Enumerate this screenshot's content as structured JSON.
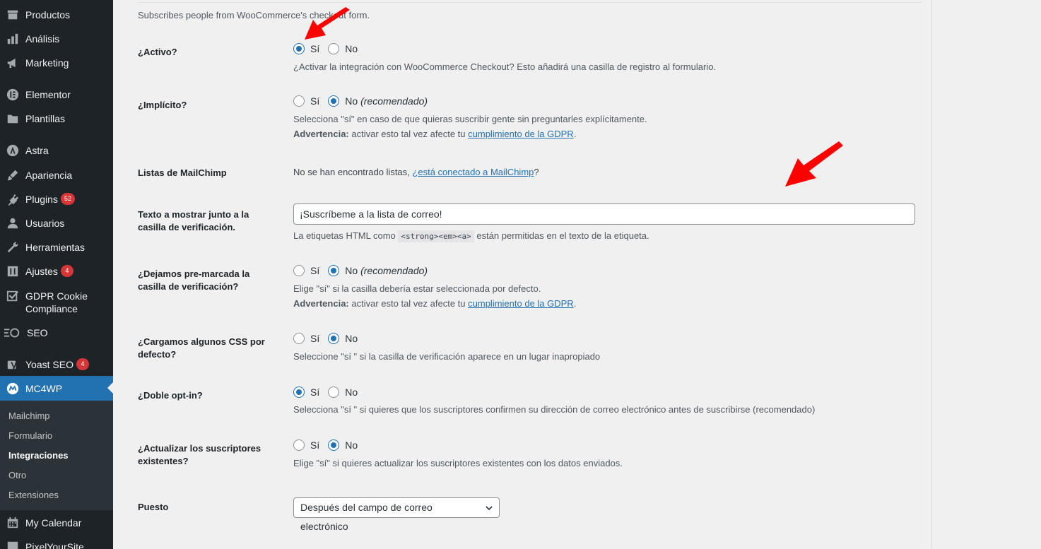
{
  "sidebar": {
    "items": [
      {
        "label": "Productos",
        "icon": "products-icon"
      },
      {
        "label": "Análisis",
        "icon": "analytics-icon"
      },
      {
        "label": "Marketing",
        "icon": "megaphone-icon"
      },
      {
        "label": "Elementor",
        "icon": "elementor-icon"
      },
      {
        "label": "Plantillas",
        "icon": "folder-icon"
      },
      {
        "label": "Astra",
        "icon": "astra-icon"
      },
      {
        "label": "Apariencia",
        "icon": "brush-icon"
      },
      {
        "label": "Plugins",
        "icon": "plugin-icon",
        "badge": "52"
      },
      {
        "label": "Usuarios",
        "icon": "users-icon"
      },
      {
        "label": "Herramientas",
        "icon": "wrench-icon"
      },
      {
        "label": "Ajustes",
        "icon": "settings-icon",
        "badge": "4"
      },
      {
        "label": "GDPR Cookie Compliance",
        "icon": "checkbox-icon"
      },
      {
        "label": "SEO",
        "icon": "seo-icon"
      },
      {
        "label": "Yoast SEO",
        "icon": "yoast-icon",
        "badge": "4"
      },
      {
        "label": "MC4WP",
        "icon": "mc4wp-icon"
      },
      {
        "label": "My Calendar",
        "icon": "calendar-icon"
      },
      {
        "label": "PixelYourSite",
        "icon": "pixel-icon"
      }
    ],
    "submenu": [
      {
        "label": "Mailchimp"
      },
      {
        "label": "Formulario"
      },
      {
        "label": "Integraciones"
      },
      {
        "label": "Otro"
      },
      {
        "label": "Extensiones"
      }
    ]
  },
  "intro": "Subscribes people from WooCommerce's checkout form.",
  "fields": {
    "activo": {
      "label": "¿Activo?",
      "yes": "Sí",
      "no": "No",
      "selected": "yes",
      "help": "¿Activar la integración con WooCommerce Checkout? Esto añadirá una casilla de registro al formulario."
    },
    "implicito": {
      "label": "¿Implícito?",
      "yes": "Sí",
      "no": "No",
      "recommended": "(recomendado)",
      "selected": "no",
      "help": "Selecciona \"sí\" en caso de que quieras suscribir gente sin preguntarles explícitamente.",
      "warning_label": "Advertencia:",
      "warning_text": "activar esto tal vez afecte tu",
      "warning_link": "cumplimiento de la GDPR"
    },
    "listas": {
      "label": "Listas de MailChimp",
      "text": "No se han encontrado listas,",
      "link": "¿está conectado a MailChimp",
      "suffix": "?"
    },
    "texto": {
      "label": "Texto a mostrar junto a la casilla de verificación.",
      "value": "¡Suscríbeme a la lista de correo!",
      "help_before": "La etiquetas HTML como",
      "code": "<strong><em><a>",
      "help_after": "están permitidas en el texto de la etiqueta."
    },
    "premarcada": {
      "label": "¿Dejamos pre-marcada la casilla de verificación?",
      "yes": "Sí",
      "no": "No",
      "recommended": "(recomendado)",
      "selected": "no",
      "help": "Elige \"sí\" si la casilla debería estar seleccionada por defecto.",
      "warning_label": "Advertencia:",
      "warning_text": "activar esto tal vez afecte tu",
      "warning_link": "cumplimiento de la GDPR"
    },
    "css": {
      "label": "¿Cargamos algunos CSS por defecto?",
      "yes": "Sí",
      "no": "No",
      "selected": "no",
      "help": "Seleccione \"sí \" si la casilla de verificación aparece en un lugar inapropiado"
    },
    "doble": {
      "label": "¿Doble opt-in?",
      "yes": "Sí",
      "no": "No",
      "selected": "yes",
      "help": "Selecciona \"sí \" si quieres que los suscriptores confirmen su dirección de correo electrónico antes de suscribirse (recomendado)"
    },
    "actualizar": {
      "label": "¿Actualizar los suscriptores existentes?",
      "yes": "Sí",
      "no": "No",
      "selected": "no",
      "help": "Elige \"sí\" si quieres actualizar los suscriptores existentes con los datos enviados."
    },
    "puesto": {
      "label": "Puesto",
      "value": "Después del campo de correo electrónico"
    }
  },
  "colors": {
    "accent": "#2271b1",
    "sidebar_bg": "#1d2327",
    "badge": "#d63638",
    "annotation_arrow": "#ff0000"
  }
}
